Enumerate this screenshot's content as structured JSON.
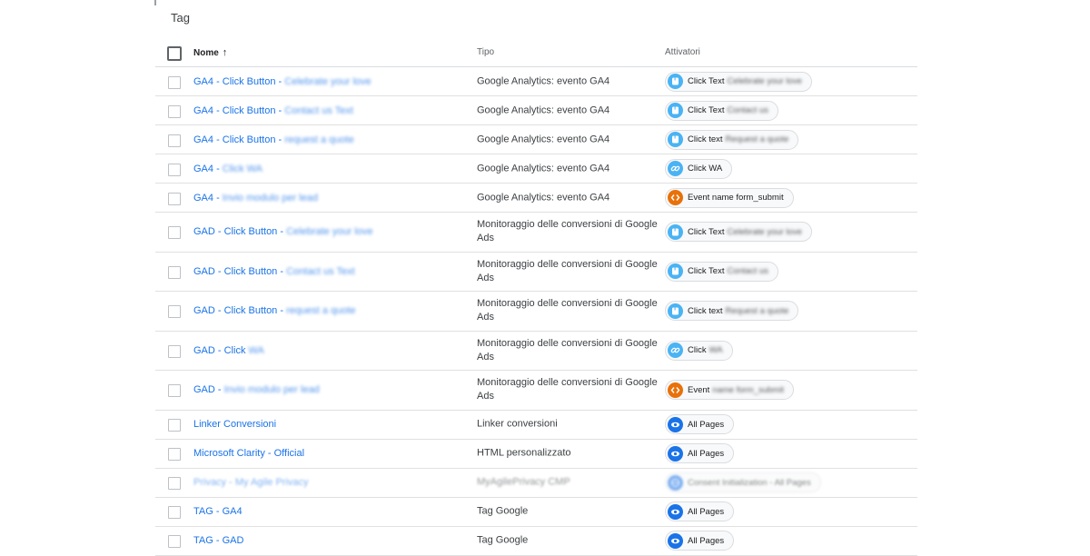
{
  "page": {
    "title": "Tag"
  },
  "header": {
    "name": "Nome",
    "type": "Tipo",
    "triggers": "Attivatori"
  },
  "rows": [
    {
      "name": "GA4 - Click Button - ",
      "name_extra": "Celebrate your love",
      "type": "Google Analytics: evento GA4",
      "trigger_icon": "pointer-icon",
      "trigger": "Click Text ",
      "trigger_extra": "Celebrate your love"
    },
    {
      "name": "GA4 - Click Button - ",
      "name_extra": "Contact us Text",
      "type": "Google Analytics: evento GA4",
      "trigger_icon": "pointer-icon",
      "trigger": "Click Text ",
      "trigger_extra": "Contact us"
    },
    {
      "name": "GA4 - Click Button - ",
      "name_extra": "request a quote",
      "type": "Google Analytics: evento GA4",
      "trigger_icon": "pointer-icon",
      "trigger": "Click text ",
      "trigger_extra": "Request a quote"
    },
    {
      "name": "GA4 - ",
      "name_extra": "Click WA",
      "type": "Google Analytics: evento GA4",
      "trigger_icon": "link-icon",
      "trigger": "Click WA",
      "trigger_extra": ""
    },
    {
      "name": "GA4 - ",
      "name_extra": "Invio modulo per lead",
      "type": "Google Analytics: evento GA4",
      "trigger_icon": "code-icon",
      "trigger": "Event name form_submit",
      "trigger_extra": ""
    },
    {
      "name": "GAD - Click Button - ",
      "name_extra": "Celebrate your love",
      "type": "Monitoraggio delle conversioni di Google Ads",
      "trigger_icon": "pointer-icon",
      "trigger": "Click Text ",
      "trigger_extra": "Celebrate your love"
    },
    {
      "name": "GAD - Click Button - ",
      "name_extra": "Contact us Text",
      "type": "Monitoraggio delle conversioni di Google Ads",
      "trigger_icon": "pointer-icon",
      "trigger": "Click Text ",
      "trigger_extra": "Contact us"
    },
    {
      "name": "GAD - Click Button - ",
      "name_extra": "request a quote",
      "type": "Monitoraggio delle conversioni di Google Ads",
      "trigger_icon": "pointer-icon",
      "trigger": "Click text ",
      "trigger_extra": "Request a quote"
    },
    {
      "name": "GAD - Click ",
      "name_extra": "WA",
      "type": "Monitoraggio delle conversioni di Google Ads",
      "trigger_icon": "link-icon",
      "trigger": "Click ",
      "trigger_extra": "WA"
    },
    {
      "name": "GAD - ",
      "name_extra": "Invio modulo per lead",
      "type": "Monitoraggio delle conversioni di Google Ads",
      "trigger_icon": "code-icon",
      "trigger": "Event ",
      "trigger_extra": "name form_submit"
    },
    {
      "name": "Linker Conversioni",
      "name_extra": "",
      "type": "Linker conversioni",
      "trigger_icon": "eye-icon",
      "trigger": "All Pages",
      "trigger_extra": ""
    },
    {
      "name": "Microsoft Clarity - Official",
      "name_extra": "",
      "type": "HTML personalizzato",
      "trigger_icon": "eye-icon",
      "trigger": "All Pages",
      "trigger_extra": ""
    },
    {
      "name": "Privacy - My Agile Privacy",
      "name_extra": "",
      "type": "MyAgilePrivacy CMP",
      "trigger_icon": "globe-icon",
      "trigger": "Consent Initialization - All Pages",
      "trigger_extra": "",
      "dimmed": true
    },
    {
      "name": "TAG - GA4",
      "name_extra": "",
      "type": "Tag Google",
      "trigger_icon": "eye-icon",
      "trigger": "All Pages",
      "trigger_extra": ""
    },
    {
      "name": "TAG - GAD",
      "name_extra": "",
      "type": "Tag Google",
      "trigger_icon": "eye-icon",
      "trigger": "All Pages",
      "trigger_extra": ""
    }
  ],
  "colors": {
    "link": "#1a73e8",
    "trigger_cyan": "#4ab3f4",
    "trigger_blue": "#1a73e8",
    "trigger_orange": "#e8710a"
  }
}
